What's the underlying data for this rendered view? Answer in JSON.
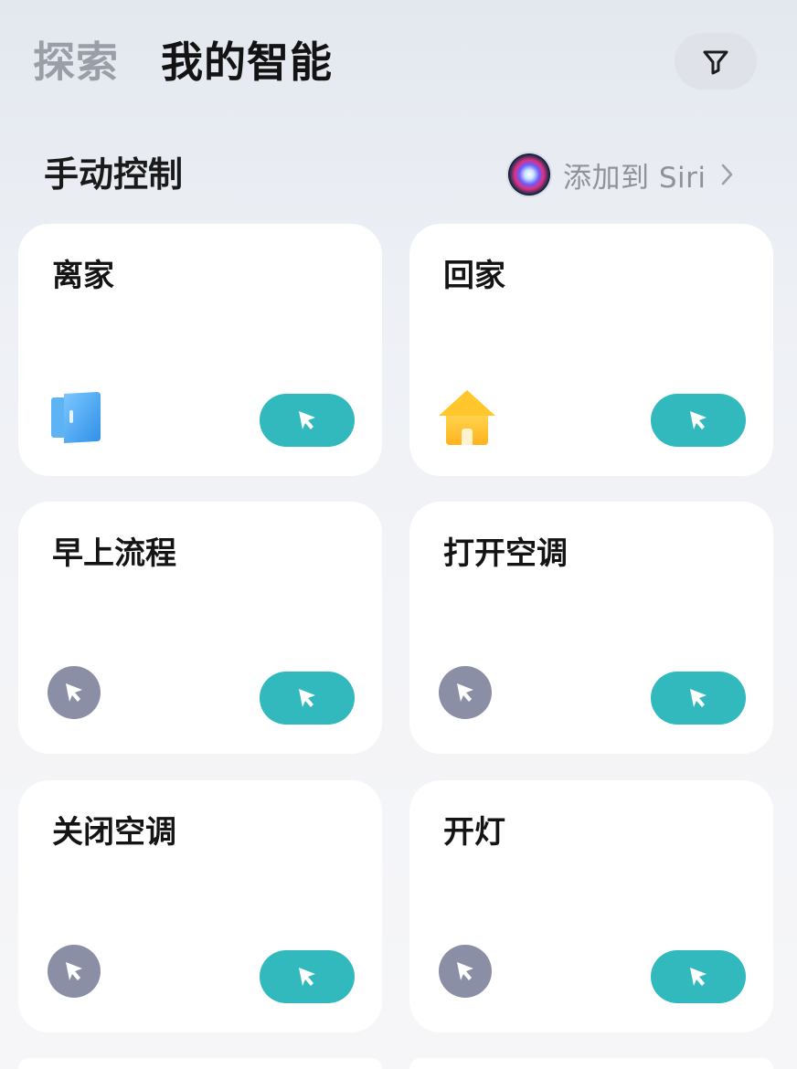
{
  "header": {
    "tabs": [
      {
        "label": "探索",
        "active": false
      },
      {
        "label": "我的智能",
        "active": true
      }
    ],
    "filter_icon": "filter-icon"
  },
  "section": {
    "title": "手动控制",
    "siri_label": "添加到 Siri",
    "siri_icon": "siri-icon",
    "chevron_icon": "chevron-right-icon"
  },
  "scenes": [
    {
      "name": "离家",
      "icon": "door-icon"
    },
    {
      "name": "回家",
      "icon": "house-icon"
    },
    {
      "name": "早上流程",
      "icon": "cursor-icon"
    },
    {
      "name": "打开空调",
      "icon": "cursor-icon"
    },
    {
      "name": "关闭空调",
      "icon": "cursor-icon"
    },
    {
      "name": "开灯",
      "icon": "cursor-icon"
    }
  ],
  "run_button_icon": "cursor-icon",
  "colors": {
    "accent": "#31b9bd",
    "card_bg": "#ffffff",
    "muted_icon_bg": "#8a8fa6",
    "tab_inactive": "#9a9ea6",
    "tab_active": "#131313"
  }
}
